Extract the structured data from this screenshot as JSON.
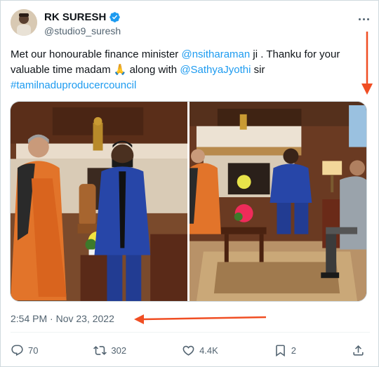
{
  "author": {
    "display_name": "RK SURESH",
    "handle": "@studio9_suresh",
    "verified": true
  },
  "tweet": {
    "text_1": "Met our honourable finance minister ",
    "mention_1": "@nsitharaman",
    "text_2": " ji . Thanku for your valuable time madam ",
    "emoji": "🙏",
    "text_3": " along with ",
    "mention_2": "@SathyaJyothi",
    "text_4": " sir",
    "hashtag": "#tamilnaduproducercouncil"
  },
  "timestamp": "2:54 PM · Nov 23, 2022",
  "actions": {
    "replies": "70",
    "retweets": "302",
    "likes": "4.4K",
    "bookmarks": "2"
  },
  "icons": {
    "more": "more-horizontal-icon",
    "reply": "reply-icon",
    "retweet": "retweet-icon",
    "like": "heart-icon",
    "bookmark": "bookmark-icon",
    "share": "share-icon",
    "verified": "verified-badge-icon"
  },
  "colors": {
    "link": "#1d9bf0",
    "secondary_text": "#536471",
    "annotation_arrow": "#f04e23"
  }
}
